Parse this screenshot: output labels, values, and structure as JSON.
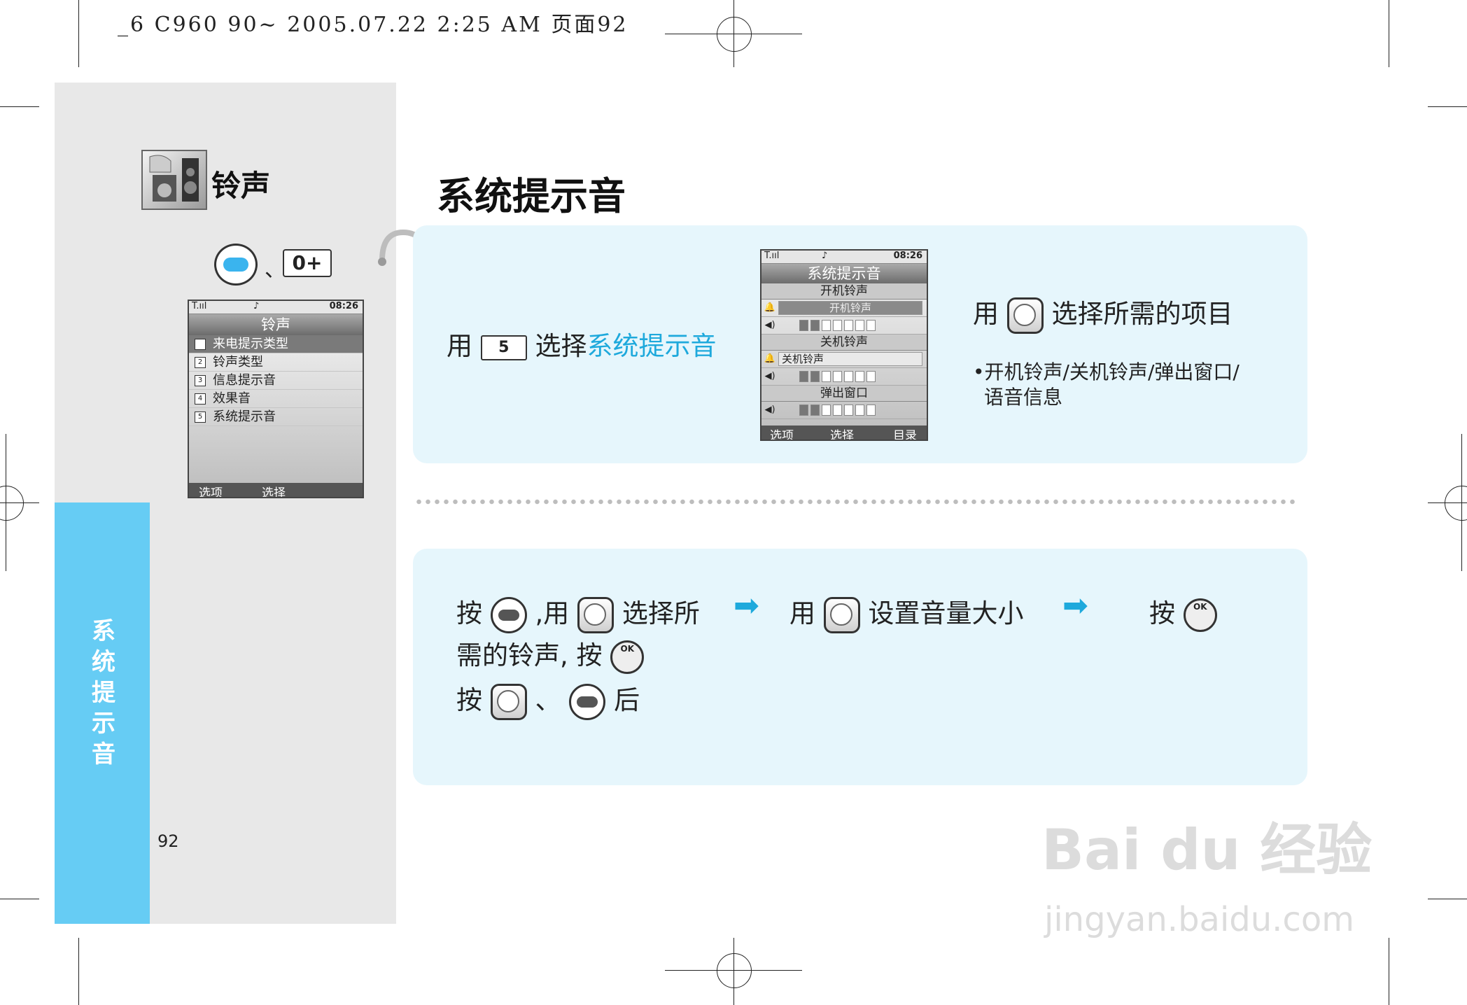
{
  "print_header": "_6 C960 90~ 2005.07.22 2:25 AM 页面92",
  "sidebar": {
    "section_title": "铃声",
    "key_separator": "、",
    "zero_key_label": "0+",
    "vertical_tab": [
      "系",
      "统",
      "提",
      "示",
      "音"
    ],
    "page_number": "92"
  },
  "phone_menu": {
    "status_time": "08:26",
    "title": "铃声",
    "items": [
      {
        "num": "1",
        "label": "来电提示类型"
      },
      {
        "num": "2",
        "label": "铃声类型"
      },
      {
        "num": "3",
        "label": "信息提示音"
      },
      {
        "num": "4",
        "label": "效果音"
      },
      {
        "num": "5",
        "label": "系统提示音"
      }
    ],
    "softkeys": [
      "选项",
      "选择"
    ]
  },
  "main": {
    "title": "系统提示音",
    "step1": {
      "prefix": "用",
      "key_label": "5",
      "middle": "选择",
      "highlight": "系统提示音"
    },
    "phone_system": {
      "status_time": "08:26",
      "title": "系统提示音",
      "section1": "开机铃声",
      "row1_value": "开机铃声",
      "section2": "关机铃声",
      "row3_value": "关机铃声",
      "section3": "弹出窗口",
      "softkeys": [
        "选项",
        "选择",
        "目录"
      ]
    },
    "step2": {
      "prefix": "用",
      "text": "选择所需的项目",
      "bullet_line1": "开机铃声/关机铃声/弹出窗口/",
      "bullet_line2": "语音信息"
    },
    "instructions": {
      "line1_press": "按",
      "line1_use": ",用",
      "line1_select": "选择所",
      "line2": "需的铃声, 按",
      "line3_press": "按",
      "line3_sep": "、",
      "line3_after": "后",
      "mid_use": "用",
      "mid_text": "设置音量大小",
      "end_press": "按",
      "ok_label": "OK"
    }
  },
  "watermark": {
    "brand": "Bai du 经验",
    "url": "jingyan.baidu.com"
  }
}
